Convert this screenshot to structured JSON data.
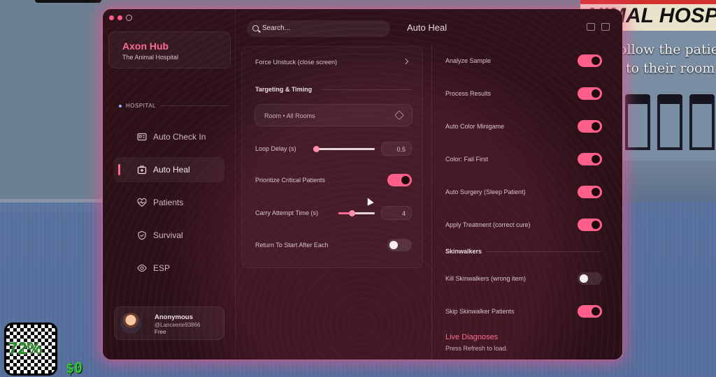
{
  "background": {
    "sign_text": "NIMAL HOSP",
    "caption_line1": "ollow the patie",
    "caption_line2": "to their room",
    "hud_percent": "72%",
    "hud_money": "$0"
  },
  "sidebar": {
    "app_name": "Axon Hub",
    "app_subtitle": "The Animal Hospital",
    "section_label": "HOSPITAL",
    "items": [
      {
        "label": "Auto Check In",
        "icon": "id-card-icon"
      },
      {
        "label": "Auto Heal",
        "icon": "medical-bag-icon"
      },
      {
        "label": "Patients",
        "icon": "heart-pulse-icon"
      },
      {
        "label": "Survival",
        "icon": "shield-icon"
      },
      {
        "label": "ESP",
        "icon": "eye-icon"
      }
    ],
    "active_item": "Auto Heal",
    "user": {
      "name": "Anonymous",
      "handle": "@Lanceerie93866",
      "plan": "Free"
    }
  },
  "header": {
    "search_placeholder": "Search...",
    "page_title": "Auto Heal"
  },
  "left_column": {
    "force_unstuck_label": "Force Unstuck (close screen)",
    "targeting_heading": "Targeting & Timing",
    "room_dropdown_value": "Room • All Rooms",
    "loop_delay": {
      "label": "Loop Delay (s)",
      "value": "0.5",
      "fraction": 0.0
    },
    "prioritize": {
      "label": "Prioritize Critical Patients",
      "on": true
    },
    "carry_attempt": {
      "label": "Carry Attempt Time (s)",
      "value": "4",
      "fraction": 0.35
    },
    "return_to_start": {
      "label": "Return To Start After Each",
      "on": false
    }
  },
  "right_column": {
    "toggles": [
      {
        "label": "Analyze Sample",
        "on": true
      },
      {
        "label": "Process Results",
        "on": true
      },
      {
        "label": "Auto Color Minigame",
        "on": true
      },
      {
        "label": "Color: Fail First",
        "on": true
      },
      {
        "label": "Auto Surgery (Sleep Patient)",
        "on": true
      },
      {
        "label": "Apply Treatment (correct cure)",
        "on": true
      }
    ],
    "skinwalkers_heading": "Skinwalkers",
    "skinwalker_toggles": [
      {
        "label": "Kill Skinwalkers (wrong item)",
        "on": false
      },
      {
        "label": "Skip Skinwalker Patients",
        "on": true
      }
    ],
    "live_title": "Live Diagnoses",
    "live_subtitle": "Press Refresh to load."
  },
  "colors": {
    "accent": "#ff5f8a",
    "window_bg": "#2a1018"
  }
}
